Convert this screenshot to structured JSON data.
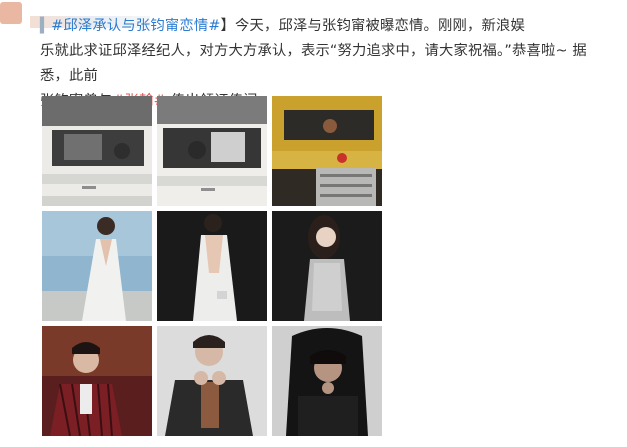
{
  "post": {
    "topic_prefix": "▍",
    "topic": "#邱泽承认与张钧甯恋情#",
    "line1_rest": "】今天，邱泽与张钧甯被曝恋情。刚刚，新浪娱",
    "line2": "乐就此求证邱泽经纪人，对方大方承认，表示“努力追求中，请大家祝福。”恭喜啦~ 据悉，此前",
    "line3_before": "张钧甯曾与",
    "mention": "#张翰#",
    "line3_after": " 传出领证传闻。"
  },
  "colors": {
    "topic": "#2b7bd1",
    "mention": "#e55757",
    "text": "#333333"
  },
  "photos": [
    {
      "name": "photo-taxi-white-1",
      "icon": "car-photo"
    },
    {
      "name": "photo-taxi-white-2",
      "icon": "car-photo"
    },
    {
      "name": "photo-taxi-yellow",
      "icon": "car-photo"
    },
    {
      "name": "photo-white-dress-front",
      "icon": "person-photo"
    },
    {
      "name": "photo-white-dress-back",
      "icon": "person-photo"
    },
    {
      "name": "photo-silver-dress",
      "icon": "person-photo"
    },
    {
      "name": "photo-man-striped-suit",
      "icon": "person-photo"
    },
    {
      "name": "photo-man-leather-jacket",
      "icon": "person-photo"
    },
    {
      "name": "photo-man-dark-chair",
      "icon": "person-photo"
    }
  ]
}
